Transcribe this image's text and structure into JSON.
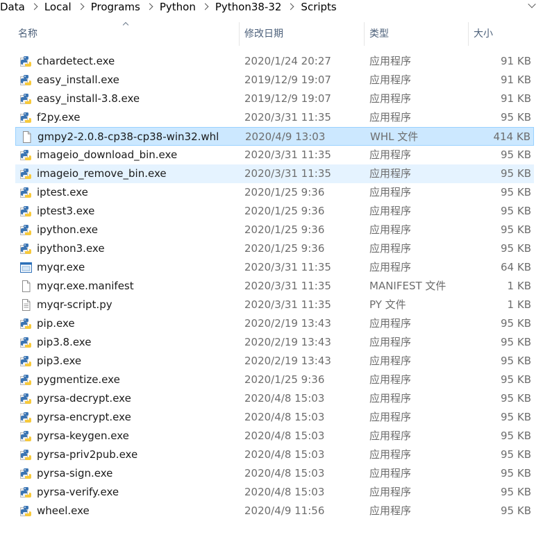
{
  "breadcrumb": {
    "items": [
      "Data",
      "Local",
      "Programs",
      "Python",
      "Python38-32",
      "Scripts"
    ]
  },
  "columns": {
    "name": "名称",
    "date": "修改日期",
    "type": "类型",
    "size": "大小"
  },
  "files": [
    {
      "name": "chardetect.exe",
      "date": "2020/1/24 20:27",
      "type": "应用程序",
      "size": "91 KB",
      "icon": "python-exe-icon"
    },
    {
      "name": "easy_install.exe",
      "date": "2019/12/9 19:07",
      "type": "应用程序",
      "size": "91 KB",
      "icon": "python-exe-icon"
    },
    {
      "name": "easy_install-3.8.exe",
      "date": "2019/12/9 19:07",
      "type": "应用程序",
      "size": "91 KB",
      "icon": "python-exe-icon"
    },
    {
      "name": "f2py.exe",
      "date": "2020/3/31 11:35",
      "type": "应用程序",
      "size": "95 KB",
      "icon": "python-exe-icon"
    },
    {
      "name": "gmpy2-2.0.8-cp38-cp38-win32.whl",
      "date": "2020/4/9 13:03",
      "type": "WHL 文件",
      "size": "414 KB",
      "icon": "blank-file-icon",
      "state": "selected"
    },
    {
      "name": "imageio_download_bin.exe",
      "date": "2020/3/31 11:35",
      "type": "应用程序",
      "size": "95 KB",
      "icon": "python-exe-icon"
    },
    {
      "name": "imageio_remove_bin.exe",
      "date": "2020/3/31 11:35",
      "type": "应用程序",
      "size": "95 KB",
      "icon": "python-exe-icon",
      "state": "hover"
    },
    {
      "name": "iptest.exe",
      "date": "2020/1/25 9:36",
      "type": "应用程序",
      "size": "95 KB",
      "icon": "python-exe-icon"
    },
    {
      "name": "iptest3.exe",
      "date": "2020/1/25 9:36",
      "type": "应用程序",
      "size": "95 KB",
      "icon": "python-exe-icon"
    },
    {
      "name": "ipython.exe",
      "date": "2020/1/25 9:36",
      "type": "应用程序",
      "size": "95 KB",
      "icon": "python-exe-icon"
    },
    {
      "name": "ipython3.exe",
      "date": "2020/1/25 9:36",
      "type": "应用程序",
      "size": "95 KB",
      "icon": "python-exe-icon"
    },
    {
      "name": "myqr.exe",
      "date": "2020/3/31 11:35",
      "type": "应用程序",
      "size": "64 KB",
      "icon": "window-app-icon"
    },
    {
      "name": "myqr.exe.manifest",
      "date": "2020/3/31 11:35",
      "type": "MANIFEST 文件",
      "size": "1 KB",
      "icon": "blank-file-icon"
    },
    {
      "name": "myqr-script.py",
      "date": "2020/3/31 11:35",
      "type": "PY 文件",
      "size": "1 KB",
      "icon": "text-file-icon"
    },
    {
      "name": "pip.exe",
      "date": "2020/2/19 13:43",
      "type": "应用程序",
      "size": "95 KB",
      "icon": "python-exe-icon"
    },
    {
      "name": "pip3.8.exe",
      "date": "2020/2/19 13:43",
      "type": "应用程序",
      "size": "95 KB",
      "icon": "python-exe-icon"
    },
    {
      "name": "pip3.exe",
      "date": "2020/2/19 13:43",
      "type": "应用程序",
      "size": "95 KB",
      "icon": "python-exe-icon"
    },
    {
      "name": "pygmentize.exe",
      "date": "2020/1/25 9:36",
      "type": "应用程序",
      "size": "95 KB",
      "icon": "python-exe-icon"
    },
    {
      "name": "pyrsa-decrypt.exe",
      "date": "2020/4/8 15:03",
      "type": "应用程序",
      "size": "95 KB",
      "icon": "python-exe-icon"
    },
    {
      "name": "pyrsa-encrypt.exe",
      "date": "2020/4/8 15:03",
      "type": "应用程序",
      "size": "95 KB",
      "icon": "python-exe-icon"
    },
    {
      "name": "pyrsa-keygen.exe",
      "date": "2020/4/8 15:03",
      "type": "应用程序",
      "size": "95 KB",
      "icon": "python-exe-icon"
    },
    {
      "name": "pyrsa-priv2pub.exe",
      "date": "2020/4/8 15:03",
      "type": "应用程序",
      "size": "95 KB",
      "icon": "python-exe-icon"
    },
    {
      "name": "pyrsa-sign.exe",
      "date": "2020/4/8 15:03",
      "type": "应用程序",
      "size": "95 KB",
      "icon": "python-exe-icon"
    },
    {
      "name": "pyrsa-verify.exe",
      "date": "2020/4/8 15:03",
      "type": "应用程序",
      "size": "95 KB",
      "icon": "python-exe-icon"
    },
    {
      "name": "wheel.exe",
      "date": "2020/4/9 11:56",
      "type": "应用程序",
      "size": "95 KB",
      "icon": "python-exe-icon"
    }
  ],
  "colors": {
    "selected_bg": "#cce8ff",
    "selected_border": "#99d1ff",
    "hover_bg": "#e5f3ff",
    "header_text": "#4c607a",
    "secondary_text": "#6d6d6d"
  }
}
